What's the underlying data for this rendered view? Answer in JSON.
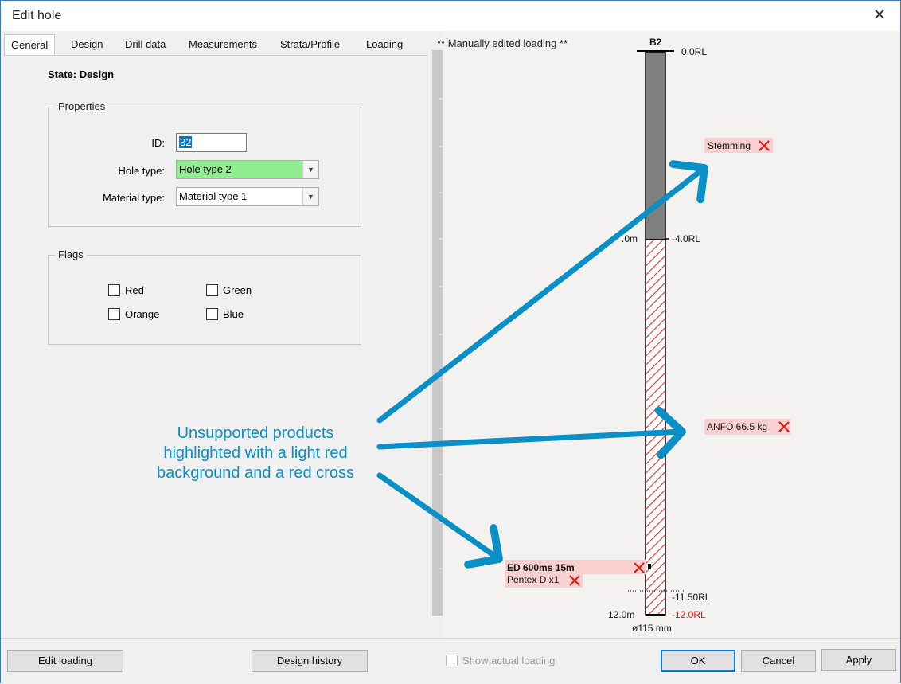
{
  "window": {
    "title": "Edit hole",
    "close_glyph": "✕"
  },
  "tabs": [
    {
      "label": "General",
      "active": true
    },
    {
      "label": "Design"
    },
    {
      "label": "Drill data"
    },
    {
      "label": "Measurements"
    },
    {
      "label": "Strata/Profile"
    },
    {
      "label": "Loading"
    }
  ],
  "general": {
    "state": "State: Design",
    "properties": {
      "title": "Properties",
      "id_label": "ID:",
      "id_value": "32",
      "hole_type_label": "Hole type:",
      "hole_type_value": "Hole type 2",
      "hole_type_color": "#90ee90",
      "material_type_label": "Material type:",
      "material_type_value": "Material type 1"
    },
    "flags": {
      "title": "Flags",
      "red": "Red",
      "green": "Green",
      "orange": "Orange",
      "blue": "Blue"
    }
  },
  "diagram": {
    "header": "** Manually edited loading **",
    "hole_name": "B2",
    "top_rl": "0.0RL",
    "stemming_rl": "-4.0RL",
    "stemming_depth": ".0m",
    "subdrill_rl": "-11.50RL",
    "bottom_rl": "-12.0RL",
    "bottom_depth": "12.0m",
    "diameter": "ø115 mm",
    "labels": {
      "stemming": "Stemming",
      "anfo": "ANFO 66.5 kg",
      "ed": "ED 600ms 15m",
      "pentex": "Pentex D x1"
    },
    "unsupported_bg": "#f8d0d0",
    "cross_color": "#e81010",
    "hatch_color": "#e03030",
    "stemming_fill": "#7f7f7f"
  },
  "annotation": {
    "line1": "Unsupported products",
    "line2": "highlighted with a light red",
    "line3": "background and a red cross",
    "color": "#0a8fc6"
  },
  "buttons": {
    "edit_loading": "Edit loading",
    "design_history": "Design history",
    "show_actual": "Show actual loading",
    "ok": "OK",
    "cancel": "Cancel",
    "apply": "Apply"
  }
}
